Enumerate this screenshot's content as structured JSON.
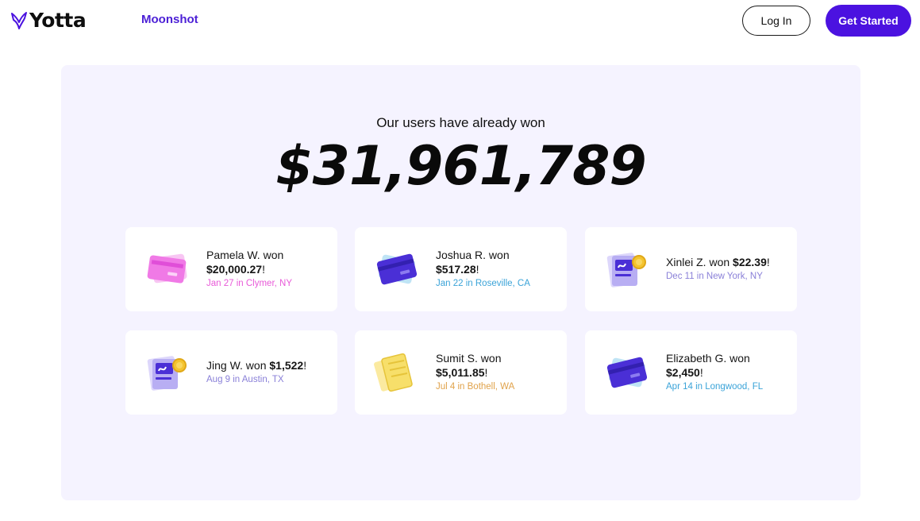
{
  "header": {
    "logo_text": "Yotta",
    "nav_link": "Moonshot",
    "login_label": "Log In",
    "get_started_label": "Get Started"
  },
  "hero": {
    "subtitle": "Our users have already won",
    "total": "$31,961,789"
  },
  "winners": [
    {
      "name_prefix": "Pamela W. won",
      "amount": "$20,000.27",
      "suffix": "!",
      "date_place": "Jan 27 in Clymer, NY",
      "meta_color": "#e85ad8",
      "icon": "pink-card-icon"
    },
    {
      "name_prefix": "Joshua R. won",
      "amount": "$517.28",
      "suffix": "!",
      "date_place": "Jan 22 in Roseville, CA",
      "meta_color": "#3aa3d8",
      "icon": "blue-card-icon"
    },
    {
      "name_prefix": "Xinlei Z. won",
      "amount": "$22.39",
      "suffix": "!",
      "date_place": "Dec 11 in New York, NY",
      "meta_color": "#8a80d8",
      "icon": "document-coin-icon"
    },
    {
      "name_prefix": "Jing W. won",
      "amount": "$1,522",
      "suffix": "!",
      "date_place": "Aug 9 in Austin, TX",
      "meta_color": "#8a80d8",
      "icon": "document-coin-icon"
    },
    {
      "name_prefix": "Sumit S. won",
      "amount": "$5,011.85",
      "suffix": "!",
      "date_place": "Jul 4 in Bothell, WA",
      "meta_color": "#e0a24a",
      "icon": "ticket-icon"
    },
    {
      "name_prefix": "Elizabeth G. won",
      "amount": "$2,450",
      "suffix": "!",
      "date_place": "Apr 14 in Longwood, FL",
      "meta_color": "#3aa3d8",
      "icon": "blue-card-icon"
    }
  ],
  "colors": {
    "brand_purple": "#4b12e0",
    "panel_bg": "#f5f3ff"
  }
}
